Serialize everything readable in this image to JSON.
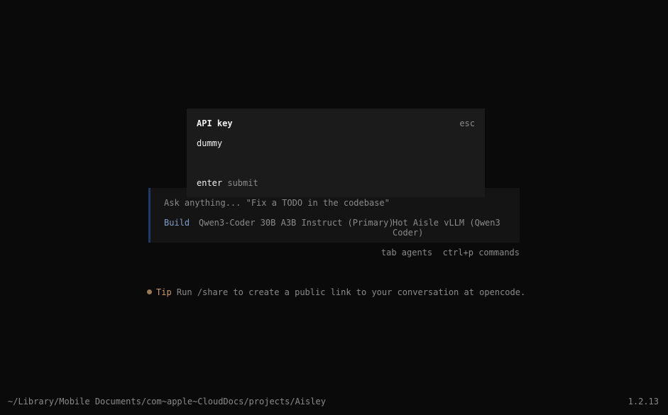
{
  "prompt": {
    "placeholder": "Ask anything... \"Fix a TODO in the codebase\"",
    "agent": "Build",
    "model": "Qwen3-Coder 30B A3B Instruct (Primary)",
    "provider": "Hot Aisle vLLM (Qwen3 Coder)"
  },
  "hints": {
    "tab_key": "tab",
    "tab_text": "agents",
    "commands_key": "ctrl+p",
    "commands_text": "commands"
  },
  "tip": {
    "label": "Tip",
    "text": "Run /share to create a public link to your conversation at opencode."
  },
  "dialog": {
    "title": "API key",
    "esc": "esc",
    "value": "dummy",
    "enter_key": "enter",
    "enter_text": "submit"
  },
  "status": {
    "path": "~/Library/Mobile Documents/com~apple~CloudDocs/projects/Aisley",
    "version": "1.2.13"
  },
  "colors": {
    "background": "#0a0a0a",
    "panel": "#141414",
    "dialog": "#1b1b1b",
    "accent_border": "#1f3a66",
    "agent": "#7f9cc8",
    "tip": "#c99a6a"
  }
}
